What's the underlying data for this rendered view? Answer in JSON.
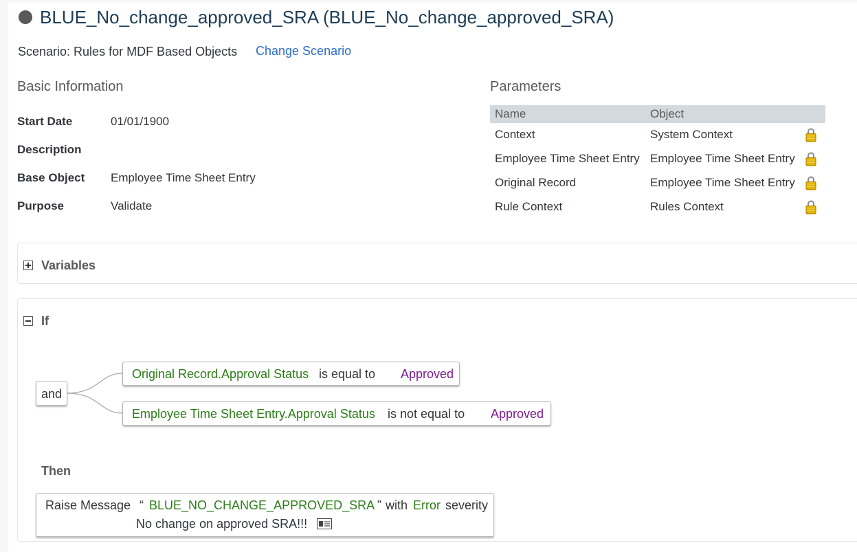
{
  "header": {
    "title": "BLUE_No_change_approved_SRA (BLUE_No_change_approved_SRA)",
    "scenario_text": "Scenario: Rules for MDF Based Objects",
    "change_scenario_label": "Change Scenario"
  },
  "basic_info": {
    "heading": "Basic Information",
    "fields": [
      {
        "label": "Start Date",
        "value": "01/01/1900"
      },
      {
        "label": "Description",
        "value": ""
      },
      {
        "label": "Base Object",
        "value": "Employee Time Sheet Entry"
      },
      {
        "label": "Purpose",
        "value": "Validate"
      }
    ]
  },
  "parameters": {
    "heading": "Parameters",
    "columns": [
      "Name",
      "Object"
    ],
    "rows": [
      {
        "name": "Context",
        "object": "System Context",
        "icon": "lock-icon"
      },
      {
        "name": "Employee Time Sheet Entry",
        "object": "Employee Time Sheet Entry",
        "icon": "lock-icon"
      },
      {
        "name": "Original Record",
        "object": "Employee Time Sheet Entry",
        "icon": "lock-icon"
      },
      {
        "name": "Rule Context",
        "object": "Rules Context",
        "icon": "lock-icon"
      }
    ]
  },
  "variables": {
    "title": "Variables",
    "expanded": false
  },
  "if_block": {
    "title": "If",
    "expanded": true,
    "operator": "and",
    "conditions": [
      {
        "field": "Original Record.Approval Status",
        "op": "is equal to",
        "value": "Approved"
      },
      {
        "field": "Employee Time Sheet Entry.Approval Status",
        "op": "is not equal to",
        "value": "Approved"
      }
    ]
  },
  "then_block": {
    "title": "Then",
    "action": {
      "prefix": "Raise Message",
      "open_quote": "“",
      "message_key": "BLUE_NO_CHANGE_APPROVED_SRA",
      "close_quote": "”",
      "with_text": "with",
      "severity": "Error",
      "severity_suffix": "severity",
      "message_text": "No change on approved SRA!!!"
    }
  },
  "colors": {
    "title": "#1d3d56",
    "link": "#2b6dc8",
    "field_green": "#2b7d16",
    "value_purple": "#7a1c8d",
    "param_header_bg": "#d4d9de",
    "lock_gold": "#e0b400"
  }
}
